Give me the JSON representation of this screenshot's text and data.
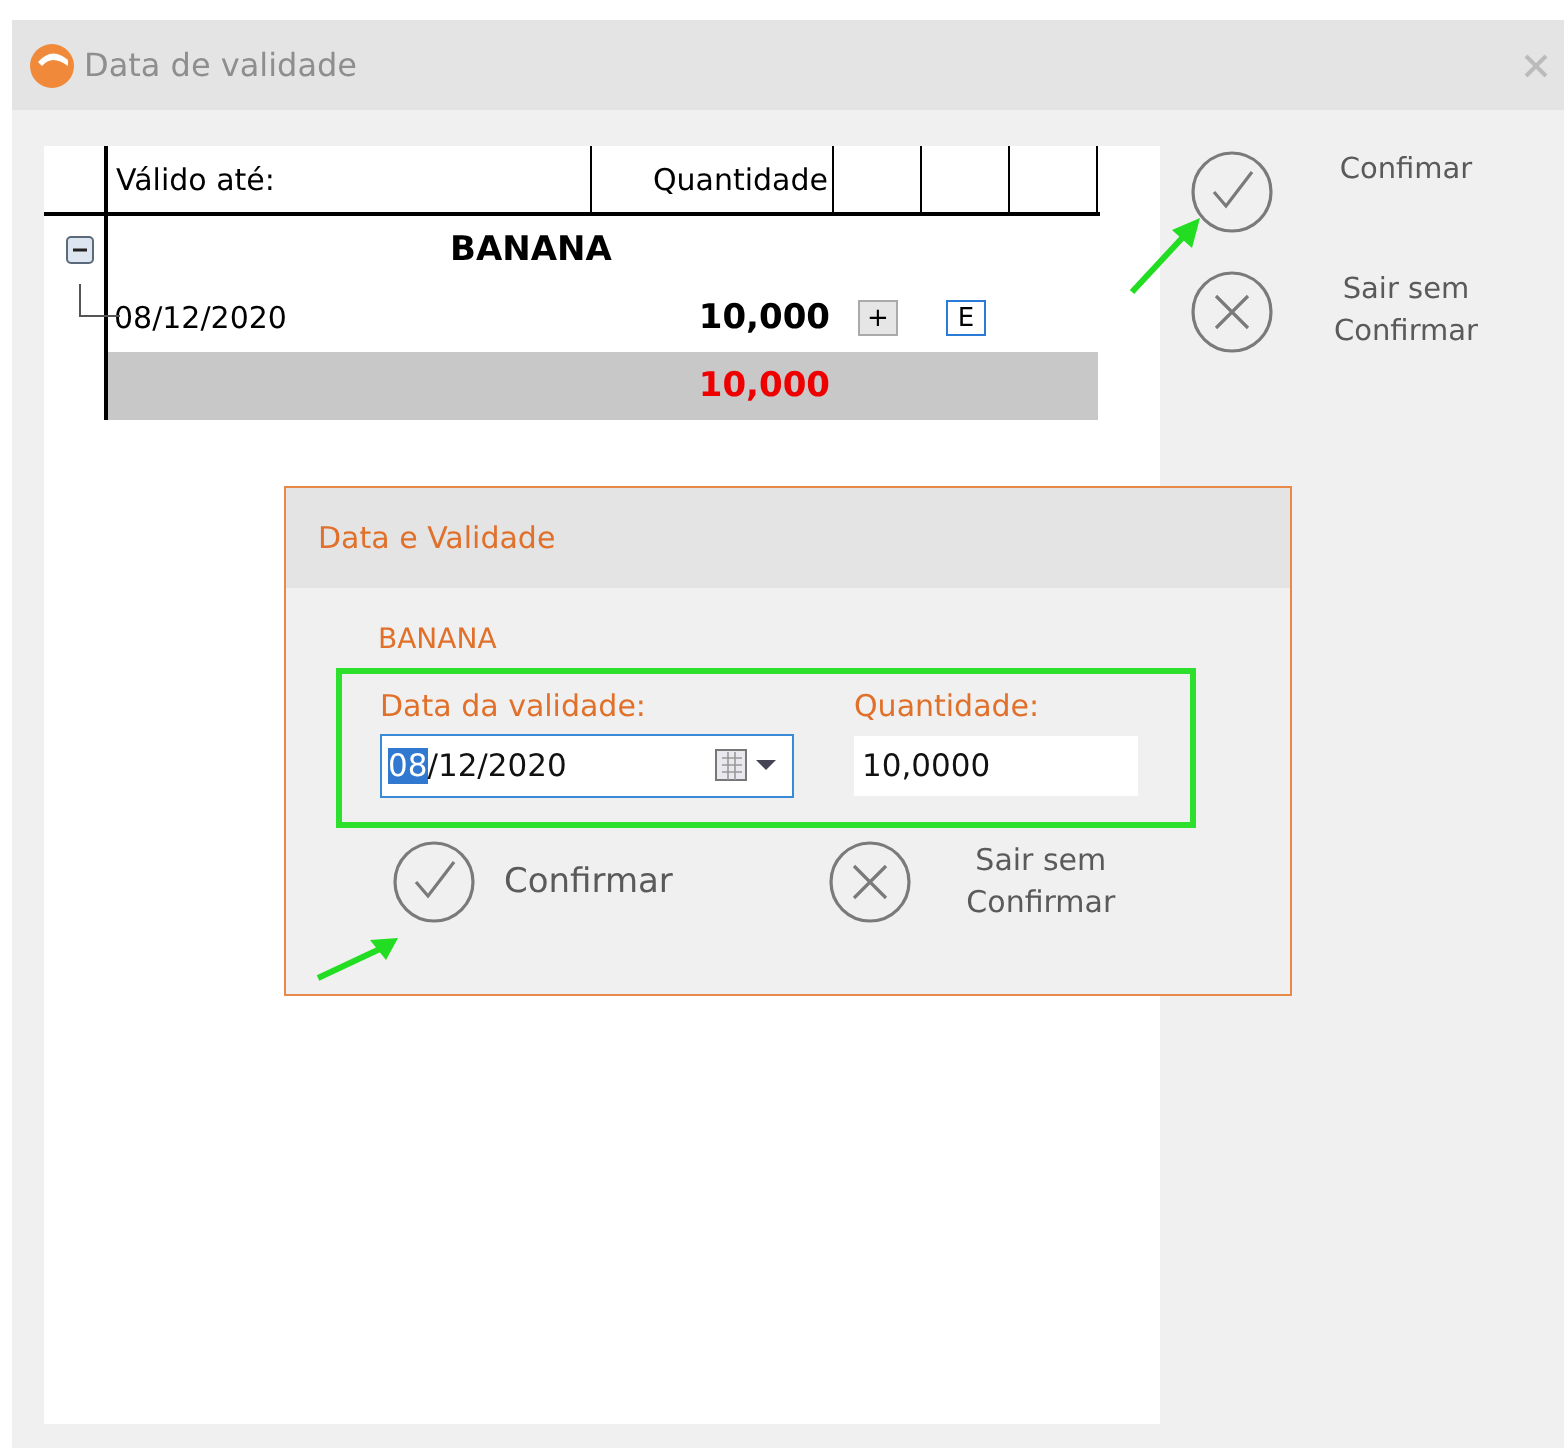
{
  "window": {
    "title": "Data de validade"
  },
  "grid": {
    "columns": [
      "Válido até:",
      "Quantidade"
    ],
    "groups": [
      {
        "name": "BANANA",
        "expanded": true,
        "rows": [
          {
            "date": "08/12/2020",
            "quantity": "10,000",
            "add": "+",
            "edit": "E"
          }
        ]
      }
    ],
    "total": "10,000"
  },
  "actions": [
    {
      "kind": "confirm",
      "label": "Confimar"
    },
    {
      "kind": "cancel",
      "label": "Sair sem Confirmar"
    }
  ],
  "dialog": {
    "title": "Data e Validade",
    "product": "BANANA",
    "fields": [
      {
        "kind": "date",
        "label": "Data da validade:",
        "value_selected": "08",
        "value": "/12/2020",
        "focused": true
      },
      {
        "kind": "number",
        "label": "Quantidade:",
        "value": "10,0000",
        "focused": false
      }
    ],
    "actions": [
      {
        "kind": "confirm",
        "label": "Confirmar"
      },
      {
        "kind": "cancel",
        "label": "Sair sem Confirmar"
      }
    ]
  }
}
